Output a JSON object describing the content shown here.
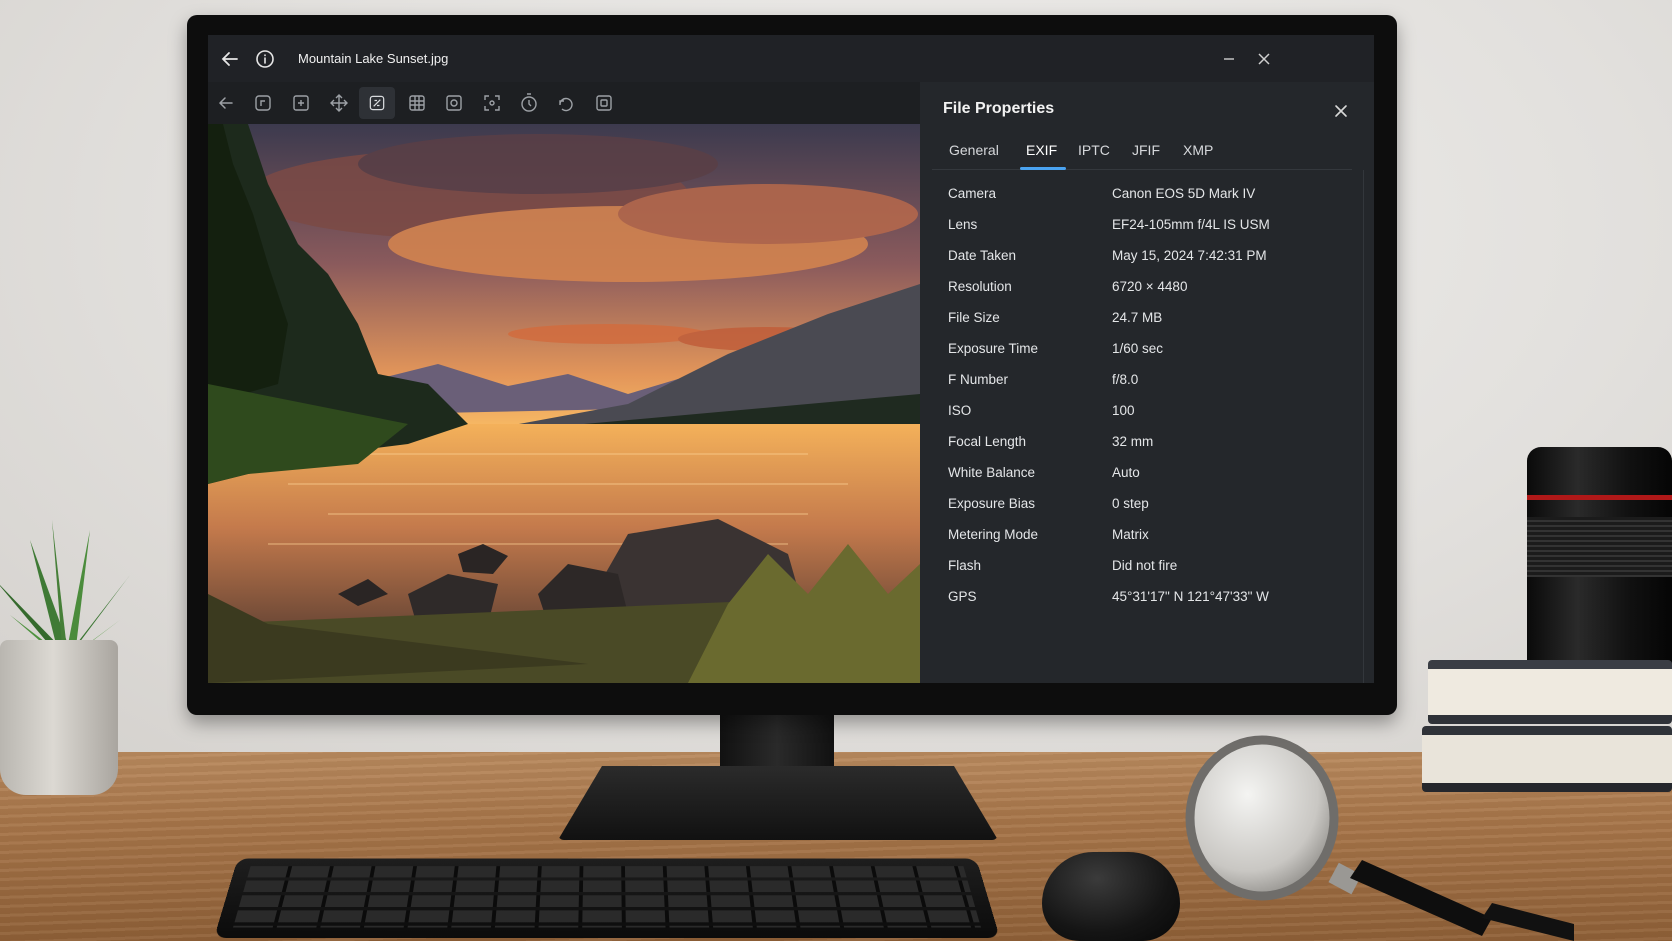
{
  "window": {
    "title": "Mountain Lake Sunset.jpg"
  },
  "toolbar": {
    "icons": [
      "back-arrow-icon",
      "rotate-icon",
      "crop-icon",
      "move-icon",
      "adjust-icon",
      "grid-icon",
      "filter-icon",
      "resize-icon",
      "timer-icon",
      "undo-icon",
      "frame-icon"
    ],
    "active_index": 4
  },
  "panel": {
    "title": "File Properties",
    "tabs": [
      {
        "label": "General"
      },
      {
        "label": "EXIF"
      },
      {
        "label": "IPTC"
      },
      {
        "label": "JFIF"
      },
      {
        "label": "XMP"
      }
    ],
    "active_tab": "EXIF",
    "properties": [
      {
        "key": "Camera",
        "value": "Canon EOS 5D Mark IV"
      },
      {
        "key": "Lens",
        "value": "EF24-105mm f/4L IS USM"
      },
      {
        "key": "Date Taken",
        "value": "May 15, 2024  7:42:31 PM"
      },
      {
        "key": "Resolution",
        "value": "6720 × 4480"
      },
      {
        "key": "File Size",
        "value": "24.7 MB"
      },
      {
        "key": "Exposure Time",
        "value": "1/60 sec"
      },
      {
        "key": "F Number",
        "value": "f/8.0"
      },
      {
        "key": "ISO",
        "value": "100"
      },
      {
        "key": "Focal Length",
        "value": "32 mm"
      },
      {
        "key": "White Balance",
        "value": "Auto"
      },
      {
        "key": "Exposure Bias",
        "value": "0 step"
      },
      {
        "key": "Metering Mode",
        "value": "Matrix"
      },
      {
        "key": "Flash",
        "value": "Did not fire"
      },
      {
        "key": "GPS",
        "value": "45°31'17\" N  121°47'33\" W"
      }
    ]
  },
  "colors": {
    "accent": "#4aa3f0",
    "panel_bg": "#24272b",
    "titlebar_bg": "#202226"
  }
}
